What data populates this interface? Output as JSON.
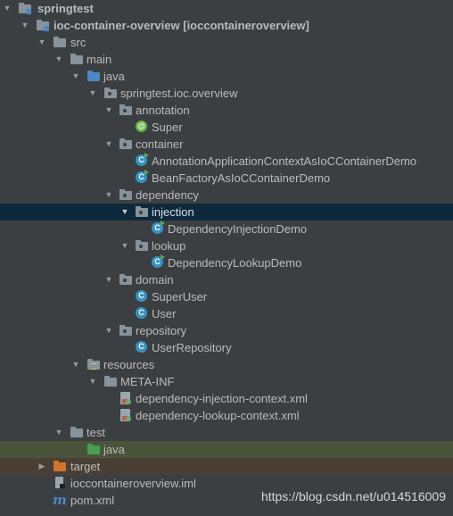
{
  "project_tree": {
    "root": {
      "label": "springtest"
    },
    "module": {
      "label": "ioc-container-overview",
      "bracket": "[ioccontaineroverview]"
    },
    "src": {
      "label": "src"
    },
    "main": {
      "label": "main"
    },
    "java": {
      "label": "java"
    },
    "package_root": {
      "label": "springtest.ioc.overview"
    },
    "annotation_pkg": {
      "label": "annotation"
    },
    "super_annotation": {
      "label": "Super",
      "icon": "annotation-icon"
    },
    "container_pkg": {
      "label": "container"
    },
    "annotation_ctx_demo": {
      "label": "AnnotationApplicationContextAsIoCContainerDemo"
    },
    "bean_factory_demo": {
      "label": "BeanFactoryAsIoCContainerDemo"
    },
    "dependency_pkg": {
      "label": "dependency"
    },
    "injection_pkg": {
      "label": "injection",
      "selected": true
    },
    "injection_demo": {
      "label": "DependencyInjectionDemo"
    },
    "lookup_pkg": {
      "label": "lookup"
    },
    "lookup_demo": {
      "label": "DependencyLookupDemo"
    },
    "domain_pkg": {
      "label": "domain"
    },
    "super_user": {
      "label": "SuperUser"
    },
    "user": {
      "label": "User"
    },
    "repository_pkg": {
      "label": "repository"
    },
    "user_repository": {
      "label": "UserRepository"
    },
    "resources": {
      "label": "resources"
    },
    "meta_inf": {
      "label": "META-INF"
    },
    "injection_xml": {
      "label": "dependency-injection-context.xml"
    },
    "lookup_xml": {
      "label": "dependency-lookup-context.xml"
    },
    "test": {
      "label": "test"
    },
    "test_java": {
      "label": "java"
    },
    "target": {
      "label": "target"
    },
    "iml_file": {
      "label": "ioccontaineroverview.iml"
    },
    "pom_file": {
      "label": "pom.xml"
    }
  },
  "watermark": "https://blog.csdn.net/u014516009",
  "colors": {
    "background": "#3c3f41",
    "selection": "#0d293e",
    "test_source_row": "#49543a",
    "excluded_row": "#4a3f35",
    "source_folder": "#4a88c7",
    "test_folder": "#499c54",
    "excluded_folder": "#d0742c"
  }
}
